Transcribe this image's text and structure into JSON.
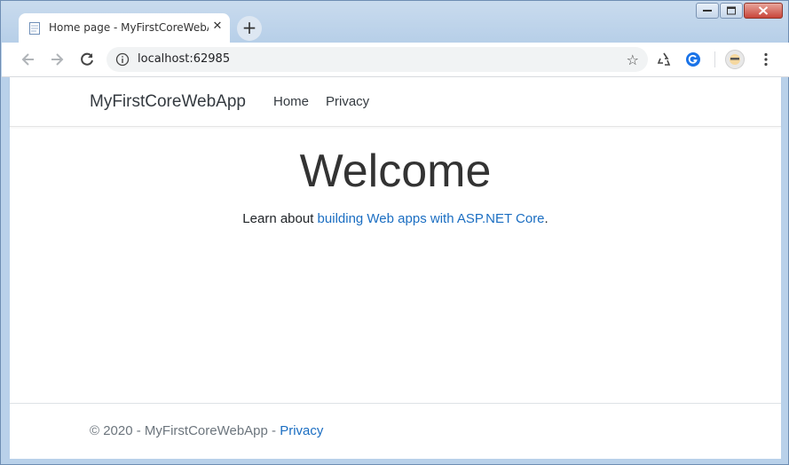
{
  "browser": {
    "tab_title": "Home page - MyFirstCoreWebApp",
    "tab_close": "✕",
    "new_tab": "+",
    "url": "localhost:62985",
    "star": "☆"
  },
  "site": {
    "brand": "MyFirstCoreWebApp",
    "nav": [
      {
        "label": "Home"
      },
      {
        "label": "Privacy"
      }
    ]
  },
  "main": {
    "heading": "Welcome",
    "learn_prefix": "Learn about ",
    "learn_link": "building Web apps with ASP.NET Core",
    "learn_suffix": "."
  },
  "footer": {
    "text": "© 2020 - MyFirstCoreWebApp - ",
    "privacy_link": "Privacy"
  },
  "colors": {
    "link": "#1b6ec2",
    "text": "#343a40",
    "chrome_accent": "#1a73e8"
  }
}
